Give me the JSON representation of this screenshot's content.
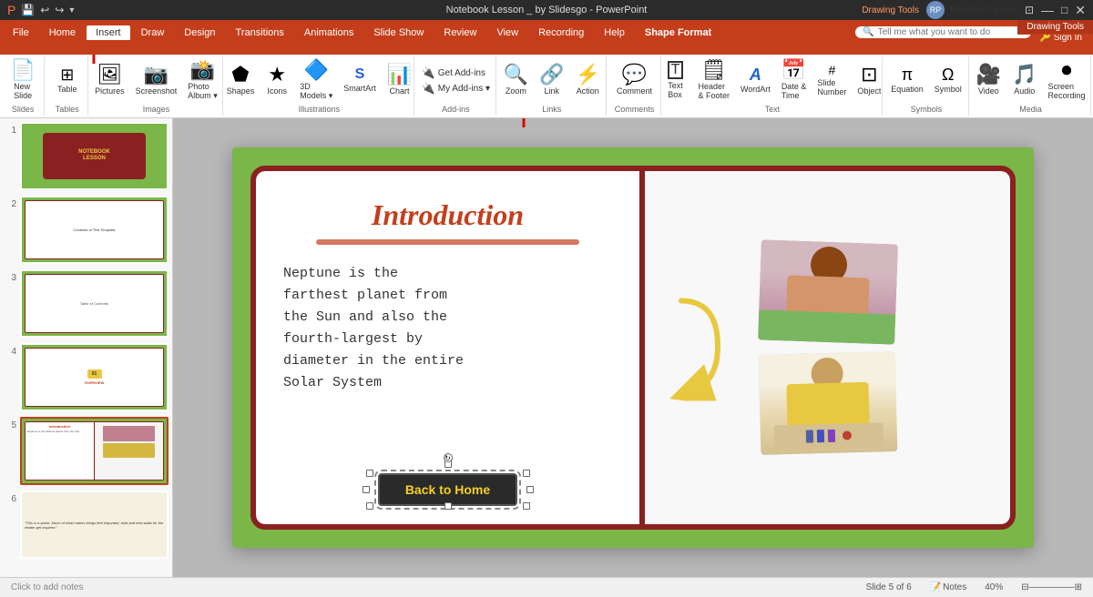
{
  "titlebar": {
    "title": "Notebook Lesson _ by Slidesgo - PowerPoint",
    "drawing_tools": "Drawing Tools",
    "user": "Roshan Perera",
    "qs_icons": [
      "🔙",
      "💾",
      "↩",
      "↪",
      "🖊"
    ]
  },
  "tabs": {
    "file": "File",
    "home": "Home",
    "insert": "Insert",
    "draw": "Draw",
    "design": "Design",
    "transitions": "Transitions",
    "animations": "Animations",
    "slideshow": "Slide Show",
    "review": "Review",
    "view": "View",
    "recording": "Recording",
    "help": "Help",
    "shape_format": "Shape Format"
  },
  "ribbon": {
    "groups": [
      {
        "name": "Slides",
        "buttons": [
          {
            "icon": "📄",
            "label": "New\nSlide"
          }
        ]
      },
      {
        "name": "Tables",
        "buttons": [
          {
            "icon": "⊞",
            "label": "Table"
          }
        ]
      },
      {
        "name": "Images",
        "buttons": [
          {
            "icon": "🖼",
            "label": "Pictures"
          },
          {
            "icon": "📷",
            "label": "Screenshot"
          },
          {
            "icon": "📸",
            "label": "Photo\nAlbum"
          }
        ]
      },
      {
        "name": "Illustrations",
        "buttons": [
          {
            "icon": "⬟",
            "label": "Shapes"
          },
          {
            "icon": "★",
            "label": "Icons"
          },
          {
            "icon": "🔷",
            "label": "3D\nModels"
          },
          {
            "icon": "A",
            "label": "SmartArt"
          },
          {
            "icon": "📊",
            "label": "Chart"
          }
        ]
      },
      {
        "name": "Add-ins",
        "buttons": [
          {
            "icon": "🔌",
            "label": "Get Add-ins"
          },
          {
            "icon": "🔌",
            "label": "My Add-ins"
          }
        ]
      },
      {
        "name": "Links",
        "buttons": [
          {
            "icon": "🔍",
            "label": "Zoom"
          },
          {
            "icon": "🔗",
            "label": "Link"
          },
          {
            "icon": "⚡",
            "label": "Action"
          }
        ]
      },
      {
        "name": "Comments",
        "buttons": [
          {
            "icon": "💬",
            "label": "Comment"
          }
        ]
      },
      {
        "name": "Text",
        "buttons": [
          {
            "icon": "T",
            "label": "Text\nBox"
          },
          {
            "icon": "🗒",
            "label": "Header\n& Footer"
          },
          {
            "icon": "A",
            "label": "WordArt"
          },
          {
            "icon": "📅",
            "label": "Date &\nTime"
          },
          {
            "icon": "#",
            "label": "Slide\nNumber"
          },
          {
            "icon": "⊡",
            "label": "Object"
          }
        ]
      },
      {
        "name": "Symbols",
        "buttons": [
          {
            "icon": "π",
            "label": "Equation"
          },
          {
            "icon": "Ω",
            "label": "Symbol"
          }
        ]
      },
      {
        "name": "Media",
        "buttons": [
          {
            "icon": "▶",
            "label": "Video"
          },
          {
            "icon": "🎵",
            "label": "Audio"
          },
          {
            "icon": "⏺",
            "label": "Screen\nRecording"
          }
        ]
      }
    ],
    "search_placeholder": "Tell me what you want to do",
    "addin_items": [
      "Get Add-ins",
      "My Add-ins ▾"
    ]
  },
  "slides": [
    {
      "num": "1",
      "active": false
    },
    {
      "num": "2",
      "active": false
    },
    {
      "num": "3",
      "active": false
    },
    {
      "num": "4",
      "active": false
    },
    {
      "num": "5",
      "active": true
    },
    {
      "num": "6",
      "active": false
    }
  ],
  "slide": {
    "title": "Introduction",
    "body_text": "Neptune is the\nfarthest planet from\nthe Sun and also the\nfourth-largest by\ndiameter in the entire\nSolar System",
    "back_button": "Back to Home"
  },
  "status_bar": {
    "text": "Click to add notes",
    "slide_info": "Slide 5 of 6",
    "notes": "Notes",
    "zoom": "40%"
  }
}
